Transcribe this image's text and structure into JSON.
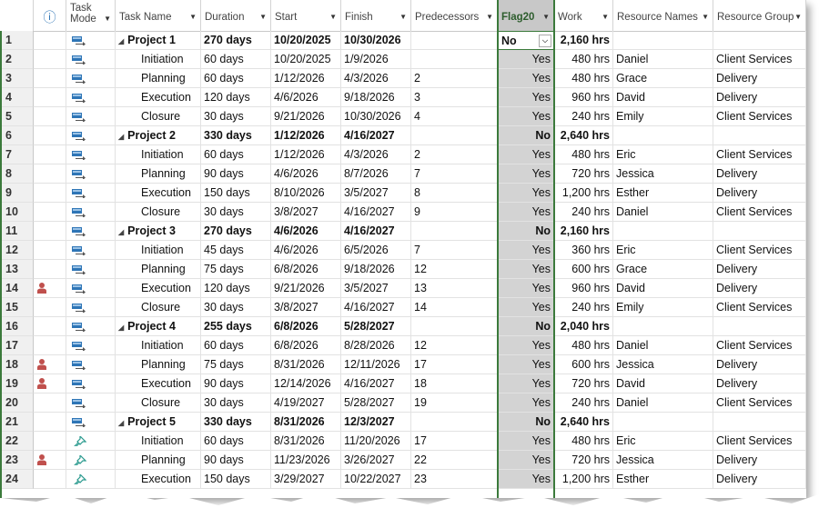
{
  "columns": {
    "indicators": "ⓘ",
    "task_mode": [
      "Task",
      "Mode"
    ],
    "task_name": "Task Name",
    "duration": "Duration",
    "start": "Start",
    "finish": "Finish",
    "predecessors": "Predecessors",
    "flag20": "Flag20",
    "work": "Work",
    "resource_names": "Resource Names",
    "resource_group": "Resource Group"
  },
  "flag20_editor_value": "No",
  "rows": [
    {
      "id": "1",
      "summary": true,
      "mode": "auto",
      "name": "Project 1",
      "duration": "270 days",
      "start": "10/20/2025",
      "finish": "10/30/2026",
      "pred": "",
      "flag": "No",
      "work": "2,160 hrs",
      "res": "",
      "group": "",
      "ind": ""
    },
    {
      "id": "2",
      "summary": false,
      "mode": "auto",
      "name": "Initiation",
      "duration": "60 days",
      "start": "10/20/2025",
      "finish": "1/9/2026",
      "pred": "",
      "flag": "Yes",
      "work": "480 hrs",
      "res": "Daniel",
      "group": "Client Services",
      "ind": ""
    },
    {
      "id": "3",
      "summary": false,
      "mode": "auto",
      "name": "Planning",
      "duration": "60 days",
      "start": "1/12/2026",
      "finish": "4/3/2026",
      "pred": "2",
      "flag": "Yes",
      "work": "480 hrs",
      "res": "Grace",
      "group": "Delivery",
      "ind": ""
    },
    {
      "id": "4",
      "summary": false,
      "mode": "auto",
      "name": "Execution",
      "duration": "120 days",
      "start": "4/6/2026",
      "finish": "9/18/2026",
      "pred": "3",
      "flag": "Yes",
      "work": "960 hrs",
      "res": "David",
      "group": "Delivery",
      "ind": ""
    },
    {
      "id": "5",
      "summary": false,
      "mode": "auto",
      "name": "Closure",
      "duration": "30 days",
      "start": "9/21/2026",
      "finish": "10/30/2026",
      "pred": "4",
      "flag": "Yes",
      "work": "240 hrs",
      "res": "Emily",
      "group": "Client Services",
      "ind": ""
    },
    {
      "id": "6",
      "summary": true,
      "mode": "auto",
      "name": "Project 2",
      "duration": "330 days",
      "start": "1/12/2026",
      "finish": "4/16/2027",
      "pred": "",
      "flag": "No",
      "work": "2,640 hrs",
      "res": "",
      "group": "",
      "ind": ""
    },
    {
      "id": "7",
      "summary": false,
      "mode": "auto",
      "name": "Initiation",
      "duration": "60 days",
      "start": "1/12/2026",
      "finish": "4/3/2026",
      "pred": "2",
      "flag": "Yes",
      "work": "480 hrs",
      "res": "Eric",
      "group": "Client Services",
      "ind": ""
    },
    {
      "id": "8",
      "summary": false,
      "mode": "auto",
      "name": "Planning",
      "duration": "90 days",
      "start": "4/6/2026",
      "finish": "8/7/2026",
      "pred": "7",
      "flag": "Yes",
      "work": "720 hrs",
      "res": "Jessica",
      "group": "Delivery",
      "ind": ""
    },
    {
      "id": "9",
      "summary": false,
      "mode": "auto",
      "name": "Execution",
      "duration": "150 days",
      "start": "8/10/2026",
      "finish": "3/5/2027",
      "pred": "8",
      "flag": "Yes",
      "work": "1,200 hrs",
      "res": "Esther",
      "group": "Delivery",
      "ind": ""
    },
    {
      "id": "10",
      "summary": false,
      "mode": "auto",
      "name": "Closure",
      "duration": "30 days",
      "start": "3/8/2027",
      "finish": "4/16/2027",
      "pred": "9",
      "flag": "Yes",
      "work": "240 hrs",
      "res": "Daniel",
      "group": "Client Services",
      "ind": ""
    },
    {
      "id": "11",
      "summary": true,
      "mode": "auto",
      "name": "Project 3",
      "duration": "270 days",
      "start": "4/6/2026",
      "finish": "4/16/2027",
      "pred": "",
      "flag": "No",
      "work": "2,160 hrs",
      "res": "",
      "group": "",
      "ind": ""
    },
    {
      "id": "12",
      "summary": false,
      "mode": "auto",
      "name": "Initiation",
      "duration": "45 days",
      "start": "4/6/2026",
      "finish": "6/5/2026",
      "pred": "7",
      "flag": "Yes",
      "work": "360 hrs",
      "res": "Eric",
      "group": "Client Services",
      "ind": ""
    },
    {
      "id": "13",
      "summary": false,
      "mode": "auto",
      "name": "Planning",
      "duration": "75 days",
      "start": "6/8/2026",
      "finish": "9/18/2026",
      "pred": "12",
      "flag": "Yes",
      "work": "600 hrs",
      "res": "Grace",
      "group": "Delivery",
      "ind": ""
    },
    {
      "id": "14",
      "summary": false,
      "mode": "auto",
      "name": "Execution",
      "duration": "120 days",
      "start": "9/21/2026",
      "finish": "3/5/2027",
      "pred": "13",
      "flag": "Yes",
      "work": "960 hrs",
      "res": "David",
      "group": "Delivery",
      "ind": "person"
    },
    {
      "id": "15",
      "summary": false,
      "mode": "auto",
      "name": "Closure",
      "duration": "30 days",
      "start": "3/8/2027",
      "finish": "4/16/2027",
      "pred": "14",
      "flag": "Yes",
      "work": "240 hrs",
      "res": "Emily",
      "group": "Client Services",
      "ind": ""
    },
    {
      "id": "16",
      "summary": true,
      "mode": "auto",
      "name": "Project 4",
      "duration": "255 days",
      "start": "6/8/2026",
      "finish": "5/28/2027",
      "pred": "",
      "flag": "No",
      "work": "2,040 hrs",
      "res": "",
      "group": "",
      "ind": ""
    },
    {
      "id": "17",
      "summary": false,
      "mode": "auto",
      "name": "Initiation",
      "duration": "60 days",
      "start": "6/8/2026",
      "finish": "8/28/2026",
      "pred": "12",
      "flag": "Yes",
      "work": "480 hrs",
      "res": "Daniel",
      "group": "Client Services",
      "ind": ""
    },
    {
      "id": "18",
      "summary": false,
      "mode": "auto",
      "name": "Planning",
      "duration": "75 days",
      "start": "8/31/2026",
      "finish": "12/11/2026",
      "pred": "17",
      "flag": "Yes",
      "work": "600 hrs",
      "res": "Jessica",
      "group": "Delivery",
      "ind": "person"
    },
    {
      "id": "19",
      "summary": false,
      "mode": "auto",
      "name": "Execution",
      "duration": "90 days",
      "start": "12/14/2026",
      "finish": "4/16/2027",
      "pred": "18",
      "flag": "Yes",
      "work": "720 hrs",
      "res": "David",
      "group": "Delivery",
      "ind": "person"
    },
    {
      "id": "20",
      "summary": false,
      "mode": "auto",
      "name": "Closure",
      "duration": "30 days",
      "start": "4/19/2027",
      "finish": "5/28/2027",
      "pred": "19",
      "flag": "Yes",
      "work": "240 hrs",
      "res": "Daniel",
      "group": "Client Services",
      "ind": ""
    },
    {
      "id": "21",
      "summary": true,
      "mode": "auto",
      "name": "Project 5",
      "duration": "330 days",
      "start": "8/31/2026",
      "finish": "12/3/2027",
      "pred": "",
      "flag": "No",
      "work": "2,640 hrs",
      "res": "",
      "group": "",
      "ind": ""
    },
    {
      "id": "22",
      "summary": false,
      "mode": "manual",
      "name": "Initiation",
      "duration": "60 days",
      "start": "8/31/2026",
      "finish": "11/20/2026",
      "pred": "17",
      "flag": "Yes",
      "work": "480 hrs",
      "res": "Eric",
      "group": "Client Services",
      "ind": ""
    },
    {
      "id": "23",
      "summary": false,
      "mode": "manual",
      "name": "Planning",
      "duration": "90 days",
      "start": "11/23/2026",
      "finish": "3/26/2027",
      "pred": "22",
      "flag": "Yes",
      "work": "720 hrs",
      "res": "Jessica",
      "group": "Delivery",
      "ind": "person"
    },
    {
      "id": "24",
      "summary": false,
      "mode": "manual",
      "name": "Execution",
      "duration": "150 days",
      "start": "3/29/2027",
      "finish": "10/22/2027",
      "pred": "23",
      "flag": "Yes",
      "work": "1,200 hrs",
      "res": "Esther",
      "group": "Delivery",
      "ind": ""
    }
  ],
  "colors": {
    "flag_border": "#3b7a3b",
    "flag_bg": "#d3d3d3",
    "person_icon": "#c0504d",
    "task_icon": "#2e75b6"
  },
  "icons": {
    "auto_mode": "auto-schedule-icon",
    "manual_mode": "manual-pin-icon",
    "person": "person-icon",
    "info": "info-icon"
  }
}
